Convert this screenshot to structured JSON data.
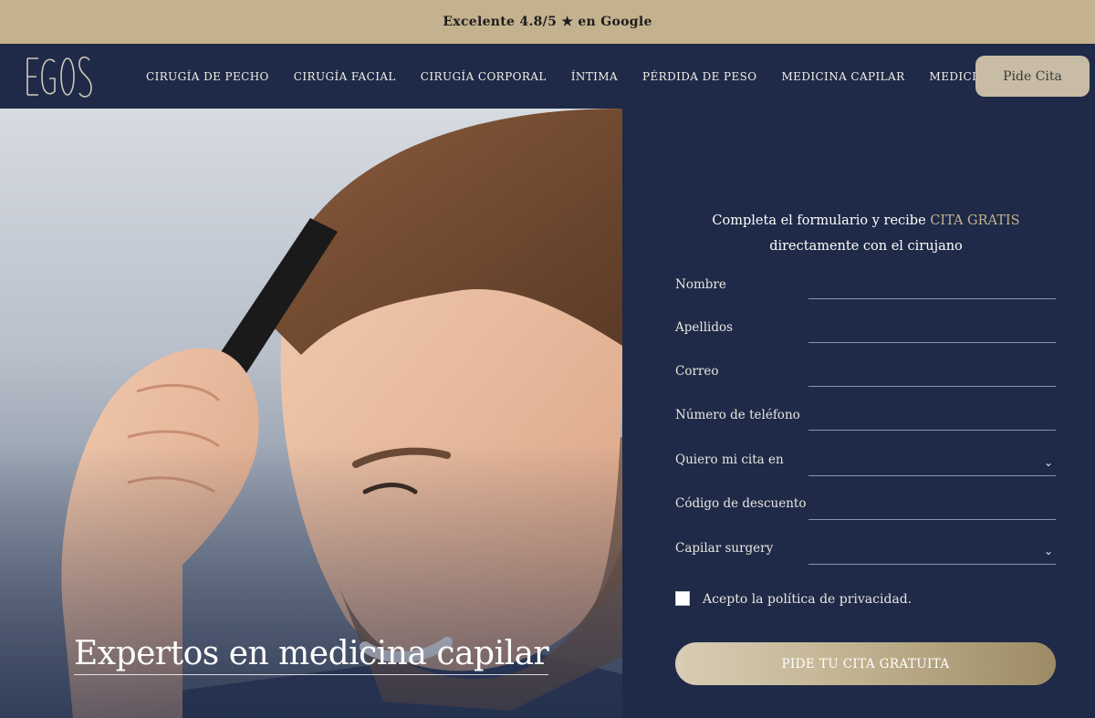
{
  "topbar": {
    "rating_text": "Excelente 4.8/5 ★ en Google"
  },
  "nav": {
    "logo_text": "EGOS",
    "items": [
      "CIRUGÍA DE PECHO",
      "CIRUGÍA FACIAL",
      "CIRUGÍA CORPORAL",
      "ÍNTIMA",
      "PÉRDIDA DE PESO",
      "MEDICINA CAPILAR",
      "MEDICINA ESTÉTICA"
    ],
    "cta_label": "Pide Cita"
  },
  "hero": {
    "title": "Expertos en medicina capilar"
  },
  "form": {
    "intro_before": "Completa el formulario y recibe ",
    "intro_accent": "CITA GRATIS",
    "intro_after": " directamente con el cirujano",
    "fields": {
      "nombre": "Nombre",
      "apellidos": "Apellidos",
      "correo": "Correo",
      "telefono": "Número de teléfono",
      "cita_en": "Quiero mi cita en",
      "descuento": "Código de descuento",
      "capilar": "Capilar surgery"
    },
    "privacy_label": "Acepto la política de privacidad.",
    "submit_label": "PIDE TU CITA GRATUITA"
  },
  "colors": {
    "navy": "#1e2a47",
    "gold": "#c4b28e",
    "button_beige": "#c8bca6"
  },
  "icons": {
    "dropdown": "chevron-down-icon"
  }
}
